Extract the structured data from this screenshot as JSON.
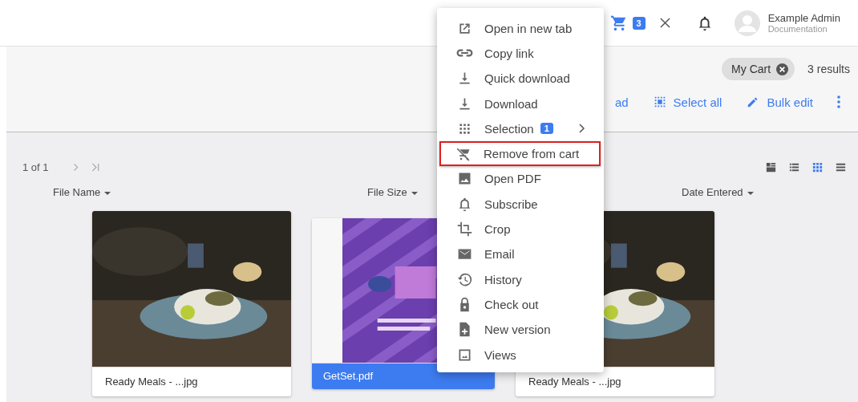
{
  "header": {
    "cart_count": "3",
    "user": {
      "name": "Example Admin",
      "role": "Documentation"
    }
  },
  "filter": {
    "chip": "My Cart",
    "results": "3 results"
  },
  "toolbar": [
    {
      "label": "ad",
      "kind": "download"
    },
    {
      "label": "Select all",
      "kind": "select"
    },
    {
      "label": "Bulk edit",
      "kind": "edit"
    }
  ],
  "pager": {
    "text": "1 of 1"
  },
  "views": [
    {
      "selected": false
    },
    {
      "selected": false
    },
    {
      "selected": true
    },
    {
      "selected": false
    }
  ],
  "columns": [
    "File Name",
    "File Size",
    "Date Entered"
  ],
  "cards": [
    {
      "caption": "Ready Meals - ...jpg",
      "selected": false,
      "kind": "picture"
    },
    {
      "caption": "GetSet.pdf",
      "selected": true,
      "kind": "picture"
    },
    {
      "caption": "Ready Meals - ...jpg",
      "selected": false,
      "kind": "picture"
    }
  ],
  "menu": [
    {
      "label": "Open in new tab",
      "highlighted": false
    },
    {
      "label": "Copy link",
      "highlighted": false
    },
    {
      "label": "Quick download",
      "highlighted": false
    },
    {
      "label": "Download",
      "highlighted": false
    },
    {
      "label": "Selection",
      "highlighted": false,
      "badge": "1",
      "submenu": true
    },
    {
      "label": "Remove from cart",
      "highlighted": true
    },
    {
      "label": "Open PDF",
      "highlighted": false
    },
    {
      "label": "Subscribe",
      "highlighted": false
    },
    {
      "label": "Crop",
      "highlighted": false
    },
    {
      "label": "Email",
      "highlighted": false
    },
    {
      "label": "History",
      "highlighted": false
    },
    {
      "label": "Check out",
      "highlighted": false
    },
    {
      "label": "New version",
      "highlighted": false
    },
    {
      "label": "Views",
      "highlighted": false
    }
  ]
}
